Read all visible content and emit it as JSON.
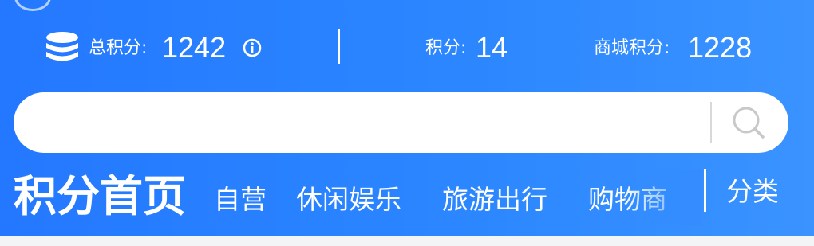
{
  "points": {
    "total_label": "总积分:",
    "total_value": "1242",
    "points_label": "积分:",
    "points_value": "14",
    "mall_label": "商城积分:",
    "mall_value": "1228"
  },
  "search": {
    "placeholder": ""
  },
  "nav": {
    "home": "积分首页",
    "tabs": [
      "自营",
      "休闲娱乐",
      "旅游出行",
      "购物商"
    ],
    "category": "分类"
  },
  "icons": {
    "coin": "coin-stack-icon",
    "info": "info-icon",
    "search": "search-icon"
  },
  "colors": {
    "header_bg": "#2b86ff",
    "text": "#ffffff"
  }
}
